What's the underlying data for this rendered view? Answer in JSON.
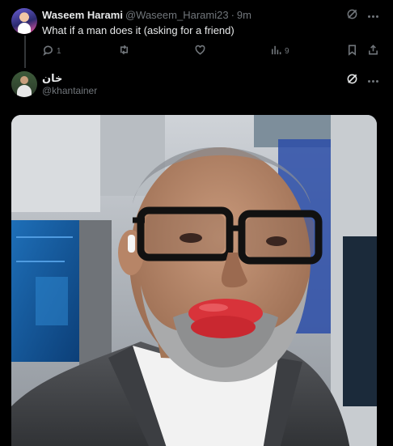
{
  "tweet": {
    "author_name": "Waseem Harami",
    "author_handle": "@Waseem_Harami23",
    "separator": "·",
    "time": "9m",
    "text": "What if a man does it (asking for a friend)",
    "reply_count": "1",
    "views_count": "9",
    "icons": [
      "grok-icon",
      "more-icon",
      "reply-icon",
      "retweet-icon",
      "like-icon",
      "views-icon",
      "bookmark-icon",
      "share-icon"
    ]
  },
  "quoted": {
    "author_name": "خان",
    "author_handle": "@khantainer",
    "icons": [
      "grok-icon",
      "more-icon"
    ]
  },
  "colors": {
    "background": "#000000",
    "text_primary": "#e7e9ea",
    "text_secondary": "#71767b",
    "divider": "#333639"
  }
}
